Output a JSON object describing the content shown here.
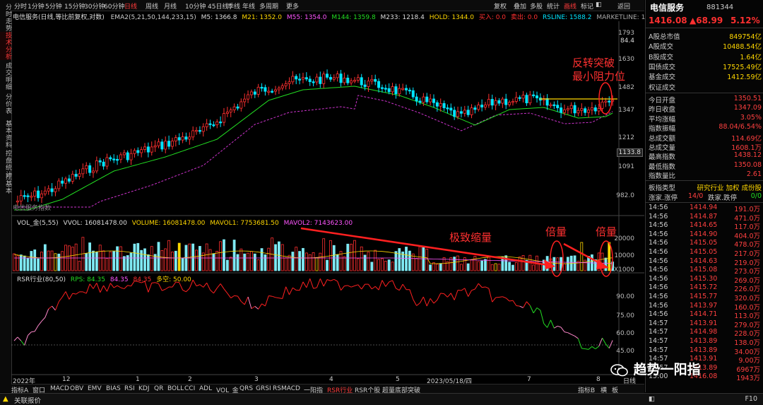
{
  "left_tabs": [
    "分时走势",
    "技术分析",
    "成交明细",
    "分价表",
    "基本资料",
    "控盘统计",
    "控基本"
  ],
  "left_active": 1,
  "toolbar": {
    "periods": [
      "分时",
      "1分钟",
      "5分钟",
      "15分钟",
      "30分钟",
      "60分钟",
      "日线",
      "周线",
      "月线",
      "10分钟",
      "45日线",
      "季线",
      "年线",
      "多周期",
      "更多"
    ],
    "selected": "日线",
    "right_tools": [
      "复权",
      "叠加",
      "多股",
      "统计",
      "画线",
      "标记",
      "◧",
      "返回"
    ],
    "right_selected": "画线"
  },
  "main_legend": {
    "title": "电信服务(日线,等比前复权,对数)",
    "ema2": "EMA2(5,21,50,144,233,15)",
    "m5": "M5: 1366.8",
    "m21": "M21: 1352.0",
    "m55": "M55: 1354.0",
    "m144": "M144: 1359.8",
    "m233": "M233: 1218.4",
    "hold": "HOLD: 1344.0",
    "buy": "买入: 0.0",
    "sell": "卖出: 0.0",
    "rsline": "RSLINE: 1588.2",
    "marketline": "MARKETLINE: 1759.7",
    "watermark": "电信服务指数"
  },
  "price_axis": [
    "1793",
    "1630",
    "1482",
    "1347",
    "1212",
    "1091",
    "982.0"
  ],
  "price_marks": {
    "top": "84.4",
    "box": "1133.8"
  },
  "vol_legend": {
    "name": "VOL_金(5,55)",
    "vvol": "VVOL: 16081478.00",
    "volume": "VOLUME: 16081478.00",
    "mavol1": "MAVOL1: 7753681.50",
    "mavol2": "MAVOL2: 7143623.00"
  },
  "vol_axis": [
    "20000",
    "10000",
    "X1000"
  ],
  "rsr_legend": {
    "name": "RSR行业(80,50)",
    "rps": "RPS: 84.35",
    "v2": "84.35",
    "v3": "84.35",
    "space": "多空: 50.00"
  },
  "rsr_axis": [
    "90.00",
    "75.00",
    "60.00",
    "45.00"
  ],
  "date_axis": [
    "2022年",
    "12",
    "1",
    "2",
    "3",
    "4",
    "5",
    "2023/05/18/四",
    "7",
    "8",
    "日线"
  ],
  "annotations": {
    "breakout_line1": "反转突破",
    "breakout_line2": "最小阻力位",
    "shrink": "极致缩量",
    "double1": "倍量",
    "double2": "倍量"
  },
  "bottom_tabs": [
    "指标A",
    "窗口",
    "MACD",
    "OBV",
    "EMV",
    "BIAS",
    "RSI",
    "KDJ",
    "QR",
    "BOLL",
    "CCI",
    "ADL",
    "VOL_金",
    "QRS",
    "GRSI",
    "RSMACD",
    "一阳指",
    "RSR行业",
    "RSR个股",
    "超量底部突破"
  ],
  "bottom_selected": "RSR行业",
  "bottom_right": [
    "指标B",
    "横",
    "板"
  ],
  "status_text": "关联报价",
  "right_panel": {
    "name": "电信服务",
    "code": "881344",
    "price": "1416.08",
    "change": "▲68.99",
    "pct": "5.12%",
    "rows1": [
      {
        "k": "A股总市值",
        "v": "849754亿"
      },
      {
        "k": "A股成交",
        "v": "10488.54亿"
      },
      {
        "k": "B股成交",
        "v": "1.64亿"
      },
      {
        "k": "国债成交",
        "v": "17525.49亿"
      },
      {
        "k": "基金成交",
        "v": "1412.59亿"
      },
      {
        "k": "权证成交",
        "v": ""
      }
    ],
    "rows2": [
      {
        "k": "今日开盘",
        "v": "1350.51"
      },
      {
        "k": "昨日收盘",
        "v": "1347.09"
      },
      {
        "k": "平均涨幅",
        "v": "3.05%"
      },
      {
        "k": "指数振幅",
        "v": "88.04/6.54%"
      },
      {
        "k": "总成交额",
        "v": "114.69亿"
      },
      {
        "k": "总成交量",
        "v": "1608.1万"
      },
      {
        "k": "最高指数",
        "v": "1438.12"
      },
      {
        "k": "最低指数",
        "v": "1350.08"
      },
      {
        "k": "指数量比",
        "v": "2.61"
      }
    ],
    "sector_label": "板指类型",
    "sector_value": "研究行业 加权 成份股",
    "updown": {
      "l1": "涨家.涨停",
      "v1": "14/0",
      "l2": "跌家.跌停",
      "v2": "0/0"
    },
    "ticks": [
      {
        "t": "14:56",
        "p": "1414.94",
        "q": "191.0万"
      },
      {
        "t": "14:56",
        "p": "1414.87",
        "q": "471.0万"
      },
      {
        "t": "14:56",
        "p": "1414.65",
        "q": "117.0万"
      },
      {
        "t": "14:56",
        "p": "1414.90",
        "q": "404.0万"
      },
      {
        "t": "14:56",
        "p": "1415.05",
        "q": "478.0万"
      },
      {
        "t": "14:56",
        "p": "1415.05",
        "q": "217.0万"
      },
      {
        "t": "14:56",
        "p": "1414.63",
        "q": "219.0万"
      },
      {
        "t": "14:56",
        "p": "1415.08",
        "q": "273.0万"
      },
      {
        "t": "14:56",
        "p": "1415.30",
        "q": "269.0万"
      },
      {
        "t": "14:56",
        "p": "1415.72",
        "q": "226.0万"
      },
      {
        "t": "14:56",
        "p": "1415.77",
        "q": "320.0万"
      },
      {
        "t": "14:56",
        "p": "1413.97",
        "q": "160.0万"
      },
      {
        "t": "14:56",
        "p": "1414.71",
        "q": "113.0万"
      },
      {
        "t": "14:57",
        "p": "1413.91",
        "q": "279.0万"
      },
      {
        "t": "14:57",
        "p": "1414.98",
        "q": "228.0万"
      },
      {
        "t": "14:57",
        "p": "1413.89",
        "q": "138.0万"
      },
      {
        "t": "14:57",
        "p": "1413.89",
        "q": "34.00万"
      },
      {
        "t": "14:57",
        "p": "1413.91",
        "q": "9.00万"
      },
      {
        "t": "14:57",
        "p": "1413.89",
        "q": "6967万"
      },
      {
        "t": "15:00",
        "p": "1416.08",
        "q": "1943万"
      }
    ],
    "watermark": "趋势一阳指",
    "bottom_tab": "F10"
  },
  "colors": {
    "up": "#ff3030",
    "down": "#00e5ff",
    "bg": "#000000",
    "accent": "#ff3b3b"
  }
}
